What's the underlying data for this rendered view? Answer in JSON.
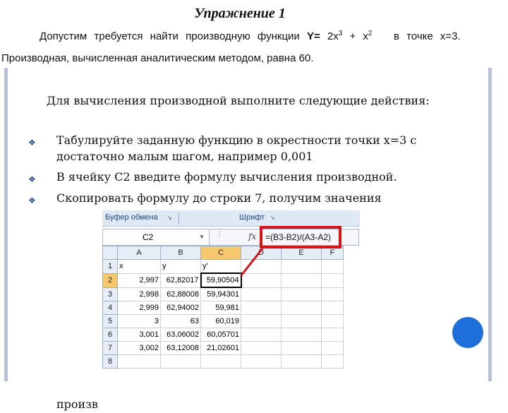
{
  "slide": {
    "title": "Упражнение 1",
    "task_text": "Допустим требуется найти производную функции",
    "function_prefix": "Y=",
    "function_term1": "2x",
    "function_exp1": "3",
    "function_plus": "+",
    "function_term2": "x",
    "function_exp2": "2",
    "point_text": "в точке x=3.",
    "result_text": "Производная, вычисленная аналитическим методом, равна 60.",
    "intro": "Для вычисления производной выполните следующие действия:",
    "bullets": [
      "Табулируйте заданную функцию в окрестности точки x=3 с достаточно малым шагом, например 0,001",
      "В ячейку С2 введите формулу вычисления производной.",
      "Скопировать формулу до строки 7, получим значения",
      "произв"
    ],
    "bullet_mark": "❖"
  },
  "excel": {
    "ribbon_group1": "Буфер обмена",
    "ribbon_group2": "Шрифт",
    "name_box": "C2",
    "fx": "fx",
    "formula": "=(B3-B2)/(A3-A2)",
    "columns": [
      "A",
      "B",
      "C",
      "D",
      "E",
      "F"
    ],
    "rows": [
      {
        "n": "1",
        "a": "x",
        "b": "y",
        "c": "y'"
      },
      {
        "n": "2",
        "a": "2,997",
        "b": "62,82017",
        "c": "59,90504"
      },
      {
        "n": "3",
        "a": "2,998",
        "b": "62,88008",
        "c": "59,94301"
      },
      {
        "n": "4",
        "a": "2,999",
        "b": "62,94002",
        "c": "59,981"
      },
      {
        "n": "5",
        "a": "3",
        "b": "63",
        "c": "60,019"
      },
      {
        "n": "6",
        "a": "3,001",
        "b": "63,06002",
        "c": "60,05701"
      },
      {
        "n": "7",
        "a": "3,002",
        "b": "63,12008",
        "c": "21,02601"
      },
      {
        "n": "8",
        "a": "",
        "b": "",
        "c": ""
      }
    ]
  },
  "colors": {
    "callout": "#d2141b",
    "circle": "#1e6fd9"
  }
}
